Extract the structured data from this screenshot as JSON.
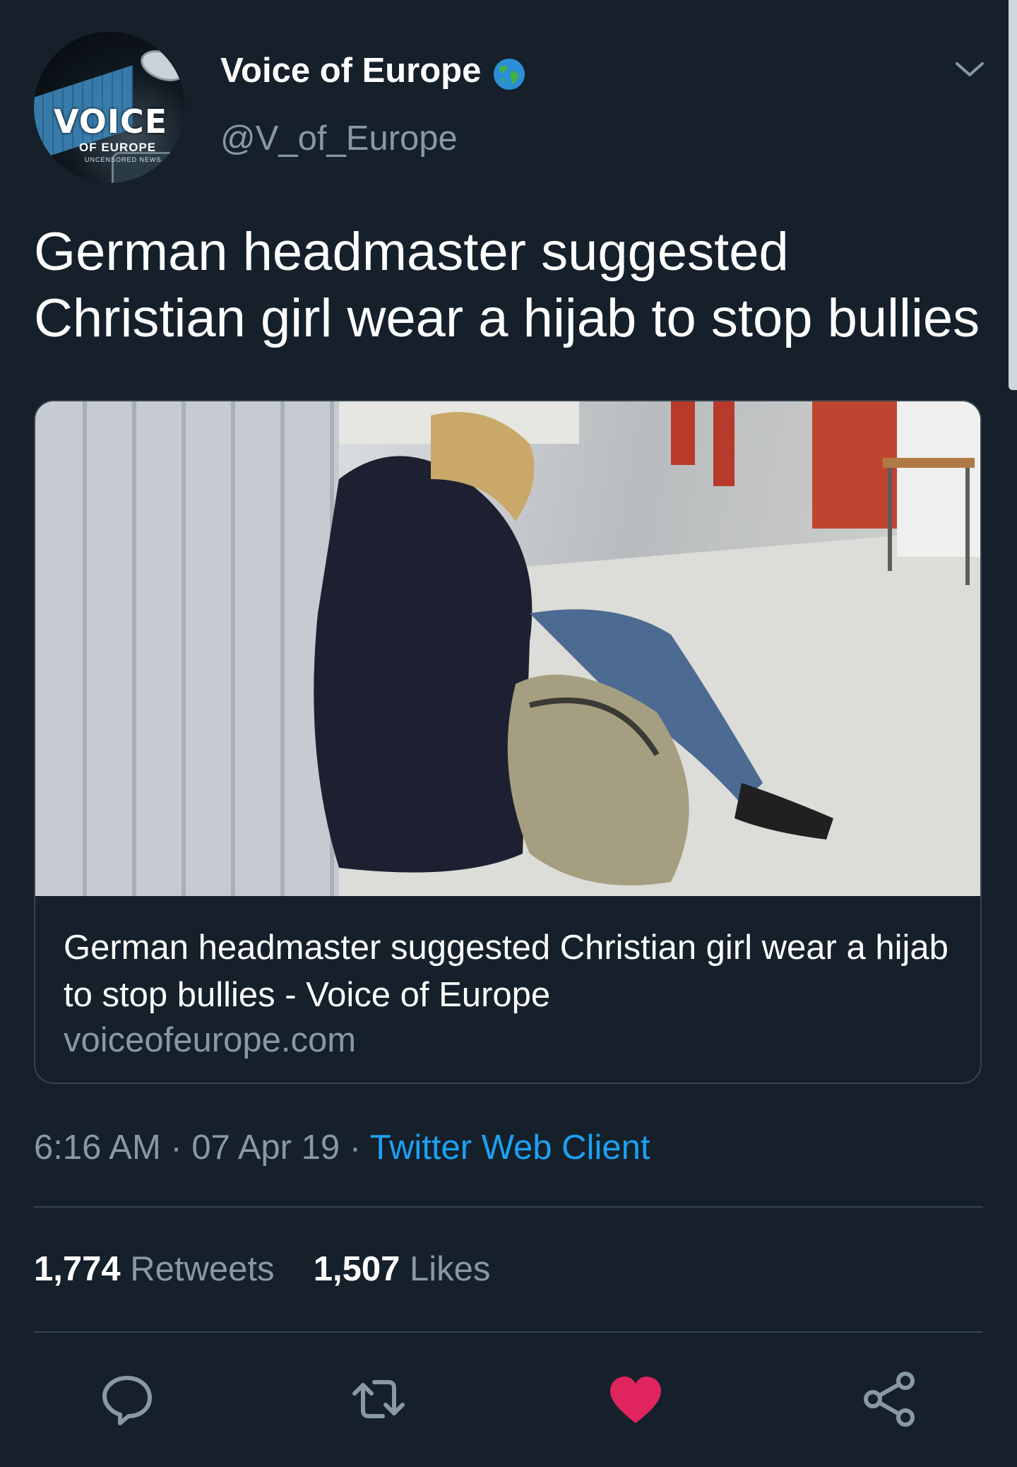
{
  "author": {
    "display_name": "Voice of Europe",
    "handle": "@V_of_Europe",
    "avatar_text": "VOICE",
    "avatar_subtext": "OF EUROPE",
    "avatar_tagline": "UNCENSORED NEWS..."
  },
  "tweet": {
    "text": "German headmaster suggested Christian girl wear a hijab to stop bullies"
  },
  "card": {
    "title": "German headmaster suggested Christian girl wear a hijab to stop bullies - Voice of Europe",
    "domain": "voiceofeurope.com"
  },
  "meta": {
    "time": "6:16 AM",
    "sep1": " · ",
    "date": "07 Apr 19",
    "sep2": " · ",
    "client": "Twitter Web Client"
  },
  "stats": {
    "retweets_count": "1,774",
    "retweets_label": "Retweets",
    "likes_count": "1,507",
    "likes_label": "Likes"
  },
  "actions": {
    "reply": "reply-icon",
    "retweet": "retweet-icon",
    "like": "heart-icon",
    "share": "share-icon"
  },
  "colors": {
    "background": "#15202b",
    "secondary_text": "#8899a6",
    "link": "#1da1f2",
    "like": "#e0245e",
    "divider": "#38444d"
  }
}
